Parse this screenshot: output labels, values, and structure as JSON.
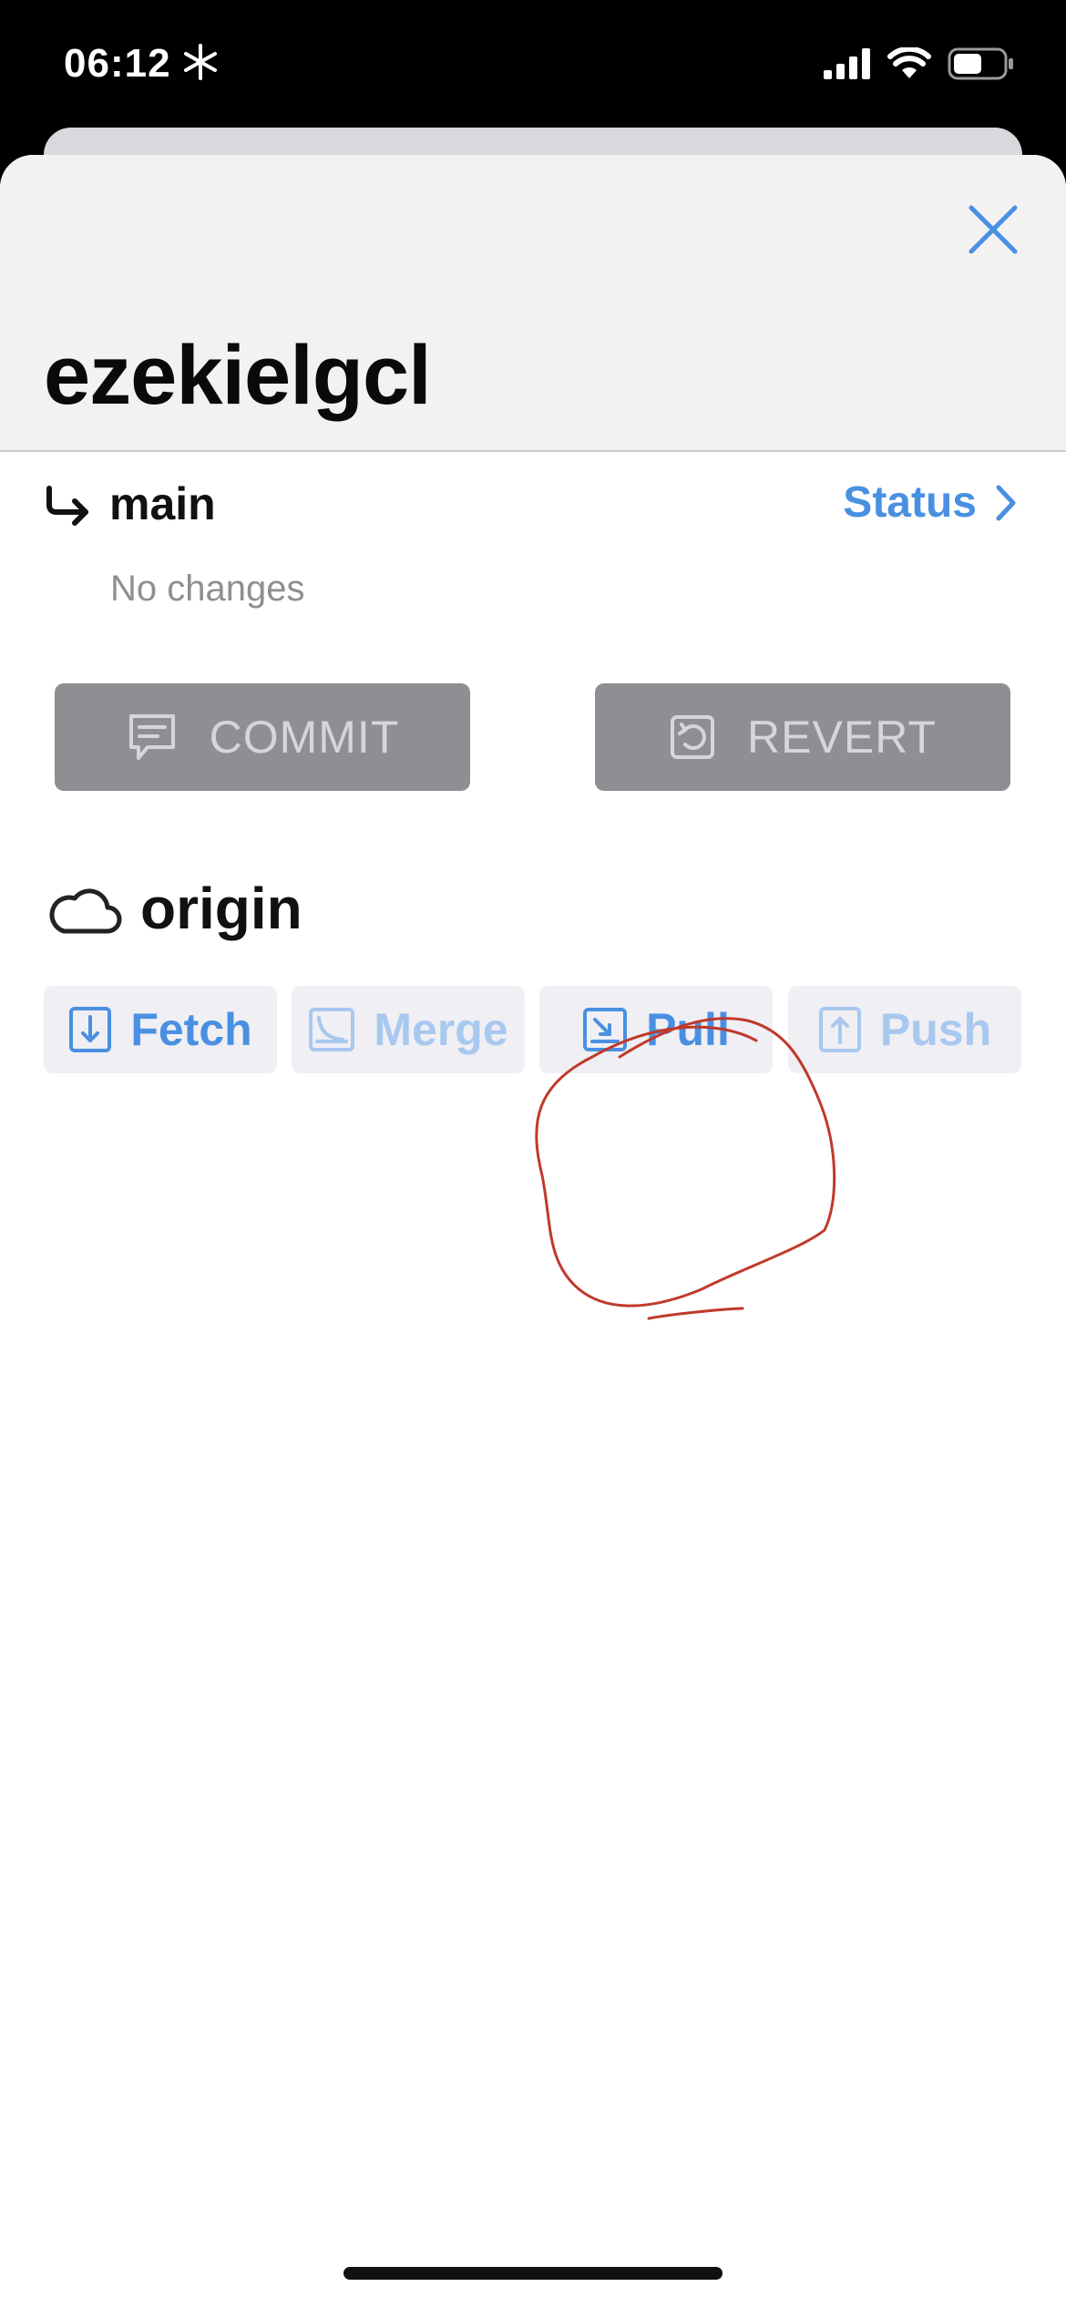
{
  "status_bar": {
    "time": "06:12",
    "icons": [
      "snowflake-icon",
      "cellular-signal-icon",
      "wifi-icon",
      "battery-icon"
    ]
  },
  "header": {
    "repo_name": "ezekielgcl",
    "close_icon": "close-icon"
  },
  "branch": {
    "name": "main",
    "status_label": "Status",
    "changes_text": "No changes"
  },
  "actions": {
    "commit_label": "COMMIT",
    "revert_label": "REVERT"
  },
  "remote": {
    "name": "origin",
    "buttons": [
      {
        "label": "Fetch",
        "enabled": true
      },
      {
        "label": "Merge",
        "enabled": false
      },
      {
        "label": "Pull",
        "enabled": true
      },
      {
        "label": "Push",
        "enabled": false
      }
    ]
  },
  "colors": {
    "accent": "#4a90e2",
    "accent_disabled": "#a9c8ef",
    "button_gray": "#8e8e93",
    "annotation_red": "#c0392b"
  }
}
